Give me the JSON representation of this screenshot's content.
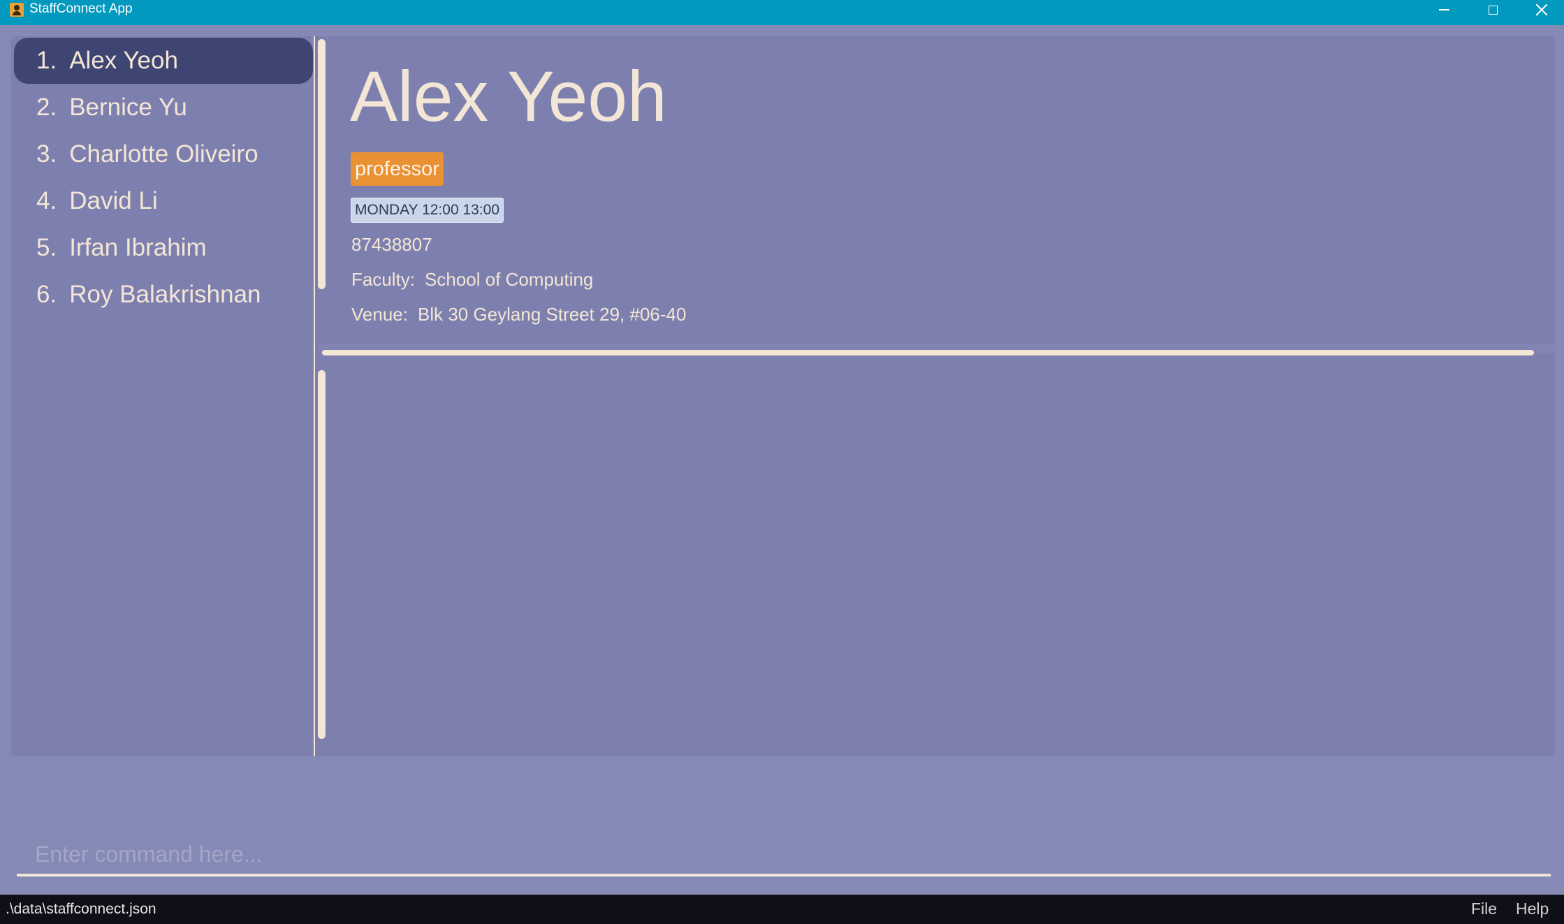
{
  "window": {
    "title": "StaffConnect App",
    "icon": "app-person-icon"
  },
  "person_list": [
    {
      "index": "1.",
      "name": "Alex Yeoh",
      "selected": true
    },
    {
      "index": "2.",
      "name": "Bernice Yu",
      "selected": false
    },
    {
      "index": "3.",
      "name": "Charlotte Oliveiro",
      "selected": false
    },
    {
      "index": "4.",
      "name": "David Li",
      "selected": false
    },
    {
      "index": "5.",
      "name": "Irfan Ibrahim",
      "selected": false
    },
    {
      "index": "6.",
      "name": "Roy Balakrishnan",
      "selected": false
    }
  ],
  "detail": {
    "name": "Alex Yeoh",
    "tag": "professor",
    "availability": "MONDAY 12:00 13:00",
    "phone": "87438807",
    "faculty_label": "Faculty:",
    "faculty": "School of Computing",
    "venue_label": "Venue:",
    "venue": "Blk 30 Geylang Street 29, #06-40"
  },
  "command": {
    "placeholder": "Enter command here..."
  },
  "status": {
    "path": ".\\data\\staffconnect.json"
  },
  "menu": {
    "file": "File",
    "help": "Help"
  },
  "colors": {
    "titlebar": "#0399bf",
    "background": "#8589b6",
    "panel": "#7d80ae",
    "selected": "#3f4573",
    "text": "#f4e6d6",
    "tag": "#ea9134",
    "availability": "#cad7ea",
    "statusbar": "#0f0f17"
  }
}
